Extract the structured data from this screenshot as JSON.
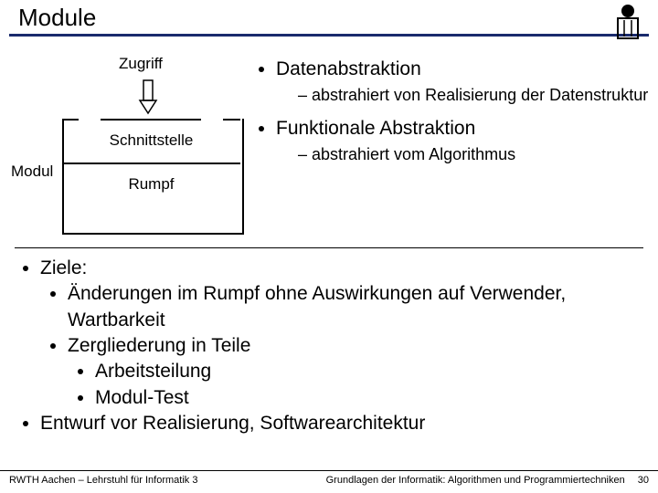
{
  "title": "Module",
  "diagram": {
    "zugriff": "Zugriff",
    "schnittstelle": "Schnittstelle",
    "rumpf": "Rumpf",
    "modul": "Modul"
  },
  "abstraktion": {
    "b1": "Datenabstraktion",
    "b1sub": "abstrahiert von Realisierung der Datenstruktur",
    "b2": "Funktionale Abstraktion",
    "b2sub": "abstrahiert vom Algorithmus"
  },
  "lower": {
    "ziele": "Ziele:",
    "z1": "Änderungen im Rumpf ohne Auswirkungen auf Verwender, Wartbarkeit",
    "z2": "Zergliederung in Teile",
    "z2a": "Arbeitsteilung",
    "z2b": "Modul-Test",
    "entwurf": "Entwurf vor Realisierung, Softwarearchitektur"
  },
  "footer": {
    "left": "RWTH Aachen – Lehrstuhl für Informatik 3",
    "course": "Grundlagen der Informatik: Algorithmen und Programmiertechniken",
    "page": "30"
  }
}
